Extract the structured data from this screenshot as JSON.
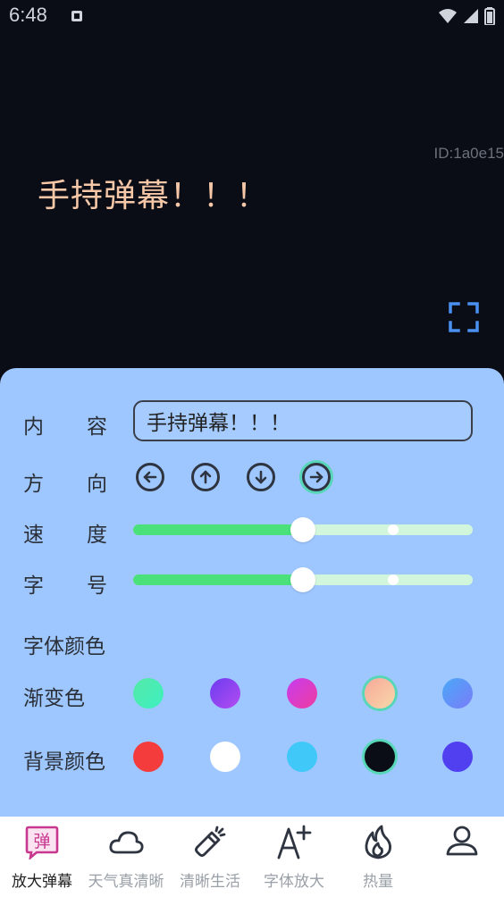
{
  "status_bar": {
    "time": "6:48"
  },
  "stage": {
    "device_id": "ID:1a0e15",
    "danmaku_text": "手持弹幕！！！",
    "text_color": "#f6c8a8",
    "background_color": "#0a0d16"
  },
  "panel": {
    "content_label": "内容",
    "content_value": "手持弹幕！！！",
    "direction_label": "方向",
    "directions": [
      "left",
      "up",
      "down",
      "right"
    ],
    "selected_direction": "right",
    "speed_label": "速度",
    "speed_value": 0.5,
    "size_label": "字号",
    "size_value": 0.5,
    "font_color_label": "字体颜色",
    "gradient_label": "渐变色",
    "gradient_colors": [
      [
        "#55e8a8",
        "#3ef0c0"
      ],
      [
        "#6b3cf0",
        "#b44cf0"
      ],
      [
        "#c63cf0",
        "#f03c9e"
      ],
      [
        "#f8a89a",
        "#f8d8a8"
      ],
      [
        "#4aa8f8",
        "#7a7cf8"
      ]
    ],
    "selected_gradient": 3,
    "background_label": "背景颜色",
    "background_colors": [
      "#f43c3c",
      "#ffffff",
      "#40c8f8",
      "#0a0d16",
      "#5040f0"
    ],
    "selected_background": 3,
    "panel_color": "#9fc7ff",
    "accent_color": "#4ae07a"
  },
  "tabs": [
    {
      "label": "放大弹幕",
      "icon": "danmaku-icon",
      "active": true
    },
    {
      "label": "天气真清晰",
      "icon": "cloud-icon",
      "active": false
    },
    {
      "label": "清晰生活",
      "icon": "flashlight-icon",
      "active": false
    },
    {
      "label": "字体放大",
      "icon": "font-plus-icon",
      "active": false
    },
    {
      "label": "热量",
      "icon": "fire-icon",
      "active": false
    },
    {
      "label": "",
      "icon": "user-icon",
      "active": false
    }
  ]
}
